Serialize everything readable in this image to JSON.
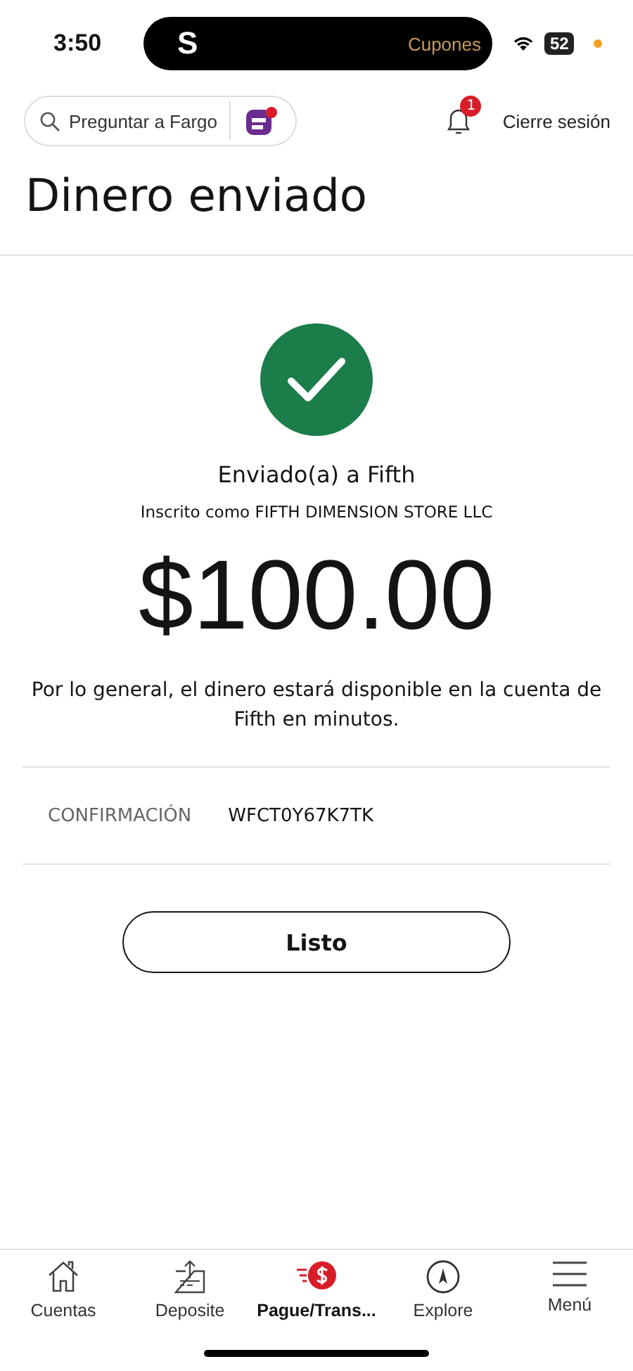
{
  "status_bar": {
    "time": "3:50",
    "activity_letter": "S",
    "activity_label": "Cupones",
    "battery": "52"
  },
  "header": {
    "search_placeholder": "Preguntar a Fargo",
    "notification_count": "1",
    "logout": "Cierre sesión"
  },
  "title": "Dinero enviado",
  "confirmation": {
    "recipient": "Enviado(a) a Fifth",
    "enrolled_as": "Inscrito como FIFTH DIMENSION STORE LLC",
    "amount": "$100.00",
    "message": "Por lo general, el dinero estará disponible en la cuenta de Fifth en minutos.",
    "code_label": "CONFIRMACIÓN",
    "code": "WFCT0Y67K7TK"
  },
  "done_button": "Listo",
  "nav": [
    {
      "label": "Cuentas",
      "kind": "home",
      "selected": false
    },
    {
      "label": "Deposite",
      "kind": "deposit",
      "selected": false
    },
    {
      "label": "Pague/Trans...",
      "kind": "pay",
      "selected": true
    },
    {
      "label": "Explore",
      "kind": "compass",
      "selected": false
    },
    {
      "label": "Menú",
      "kind": "menu",
      "selected": false
    }
  ]
}
